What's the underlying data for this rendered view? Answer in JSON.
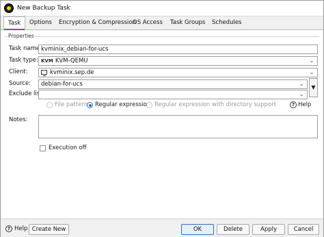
{
  "window": {
    "title": "New Backup Task"
  },
  "tabs": [
    {
      "label": "Task"
    },
    {
      "label": "Options"
    },
    {
      "label": "Encryption & Compression"
    },
    {
      "label": "OS Access"
    },
    {
      "label": "Task Groups"
    },
    {
      "label": "Schedules"
    }
  ],
  "properties": {
    "group_title": "Properties",
    "task_name_label": "Task name:",
    "task_name_value": "kvminix_debian-for-ucs",
    "task_type_label": "Task type:",
    "task_type_badge": "KVM",
    "task_type_value": "KVM-QEMU",
    "client_label": "Client:",
    "client_value": "kvminix.sep.de",
    "source_label": "Source:",
    "source_value": "debian-for-ucs",
    "exclude_label": "Exclude list:",
    "exclude_value": "",
    "radio_file_pattern": "File pattern",
    "radio_regex": "Regular expression",
    "radio_regex_dir": "Regular expression with directory support",
    "help_label": "Help",
    "notes_label": "Notes:",
    "execution_off_label": "Execution off"
  },
  "footer": {
    "help_label": "Help",
    "create_new": "Create New",
    "ok": "OK",
    "delete": "Delete",
    "apply": "Apply",
    "cancel": "Cancel"
  },
  "icons": {
    "dropdown": "chevron-down-icon",
    "menu": "triangle-down-icon",
    "help": "question-circle-icon"
  },
  "colors": {
    "accent": "#2f6fb7"
  }
}
